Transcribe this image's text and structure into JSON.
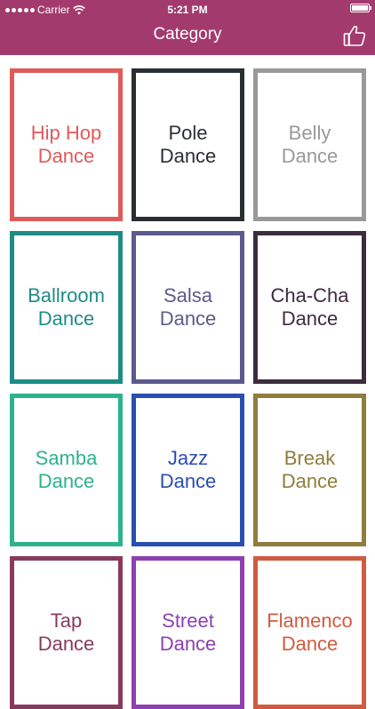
{
  "status_bar": {
    "carrier": "Carrier",
    "time": "5:21 PM"
  },
  "header": {
    "title": "Category",
    "background": "#a33a6d",
    "right_icon": "thumbs-up-icon"
  },
  "categories": [
    {
      "label": "Hip Hop\nDance",
      "color": "#e05a5a"
    },
    {
      "label": "Pole\nDance",
      "color": "#2b2f33"
    },
    {
      "label": "Belly\nDance",
      "color": "#999999"
    },
    {
      "label": "Ballroom\nDance",
      "color": "#1e8c86"
    },
    {
      "label": "Salsa\nDance",
      "color": "#5b5a8d"
    },
    {
      "label": "Cha-Cha\nDance",
      "color": "#3d2c3e"
    },
    {
      "label": "Samba\nDance",
      "color": "#2db38c"
    },
    {
      "label": "Jazz\nDance",
      "color": "#2a4eb1"
    },
    {
      "label": "Break\nDance",
      "color": "#8f7d3b"
    },
    {
      "label": "Tap\nDance",
      "color": "#883a5c"
    },
    {
      "label": "Street\nDance",
      "color": "#8e3fb2"
    },
    {
      "label": "Flamenco\nDance",
      "color": "#d05b3f"
    }
  ]
}
